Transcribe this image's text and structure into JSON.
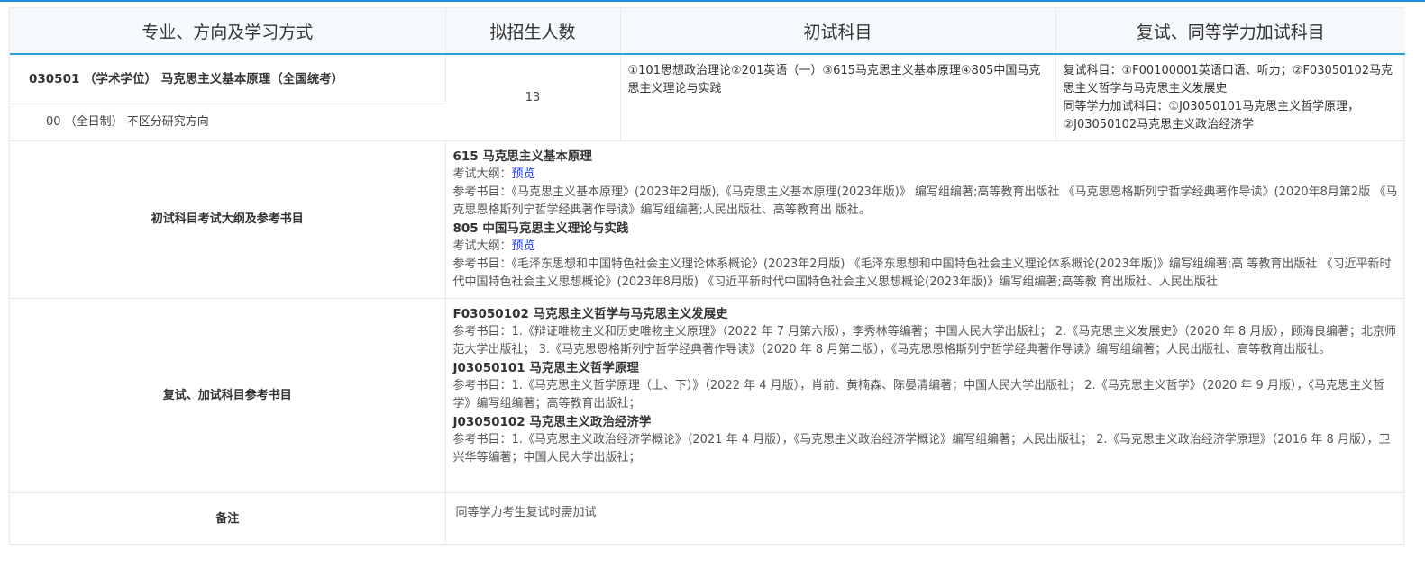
{
  "headers": [
    "专业、方向及学习方式",
    "拟招生人数",
    "初试科目",
    "复试、同等学力加试科目"
  ],
  "major": {
    "title": "030501 （学术学位） 马克思主义基本原理（全国统考）",
    "direction": "00 （全日制） 不区分研究方向",
    "count": "13",
    "exam_subjects": "①101思想政治理论②201英语（一）③615马克思主义基本原理④805中国马克思主义理论与实践",
    "retest_line1": "复试科目：①F00100001英语口语、听力；②F03050102马克思主义哲学与马克思主义发展史",
    "retest_line2": "同等学力加试科目：①J03050101马克思主义哲学原理，②J03050102马克思主义政治经济学"
  },
  "exam_refs": {
    "label": "初试科目考试大纲及参考书目",
    "items": [
      {
        "subject": "615 马克思主义基本原理",
        "outline_prefix": "考试大纲：",
        "outline_link": "预览",
        "books": "参考书目：《马克思主义基本原理》(2023年2月版),《马克思主义基本原理(2023年版)》 编写组编著;高等教育出版社 《马克思恩格斯列宁哲学经典著作导读》(2020年8月第2版 《马克思恩格斯列宁哲学经典著作导读》编写组编著;人民出版社、高等教育出 版社。"
      },
      {
        "subject": "805 中国马克思主义理论与实践",
        "outline_prefix": "考试大纲：",
        "outline_link": "预览",
        "books": "参考书目：《毛泽东思想和中国特色社会主义理论体系概论》(2023年2月版) 《毛泽东思想和中国特色社会主义理论体系概论(2023年版)》编写组编著;高 等教育出版社 《习近平新时代中国特色社会主义思想概论》(2023年8月版) 《习近平新时代中国特色社会主义思想概论(2023年版)》编写组编著;高等教 育出版社、人民出版社"
      }
    ]
  },
  "retest_refs": {
    "label": "复试、加试科目参考书目",
    "items": [
      {
        "subject": "F03050102 马克思主义哲学与马克思主义发展史",
        "books": "参考书目：1.《辩证唯物主义和历史唯物主义原理》（2022 年 7 月第六版），李秀林等编著；中国人民大学出版社； 2.《马克思主义发展史》（2020 年 8 月版），顾海良编著；北京师范大学出版社； 3.《马克思恩格斯列宁哲学经典著作导读》（2020 年 8 月第二版），《马克思恩格斯列宁哲学经典著作导读》编写组编著；人民出版社、高等教育出版社。"
      },
      {
        "subject": "J03050101 马克思主义哲学原理",
        "books": "参考书目：1.《马克思主义哲学原理（上、下）》（2022 年 4 月版），肖前、黄楠森、陈晏清编著；中国人民大学出版社； 2.《马克思主义哲学》（2020 年 9 月版），《马克思主义哲学》编写组编著；高等教育出版社；"
      },
      {
        "subject": "J03050102 马克思主义政治经济学",
        "books": "参考书目：1.《马克思主义政治经济学概论》（2021 年 4 月版），《马克思主义政治经济学概论》编写组编著；人民出版社； 2.《马克思主义政治经济学原理》（2016 年 8 月版），卫兴华等编著；中国人民大学出版社；"
      }
    ]
  },
  "remarks": {
    "label": "备注",
    "text": "同等学力考生复试时需加试"
  },
  "colors": {
    "accent": "#2a9ddd",
    "link": "#1a3cff",
    "header_bg": "#f6f9fc"
  }
}
